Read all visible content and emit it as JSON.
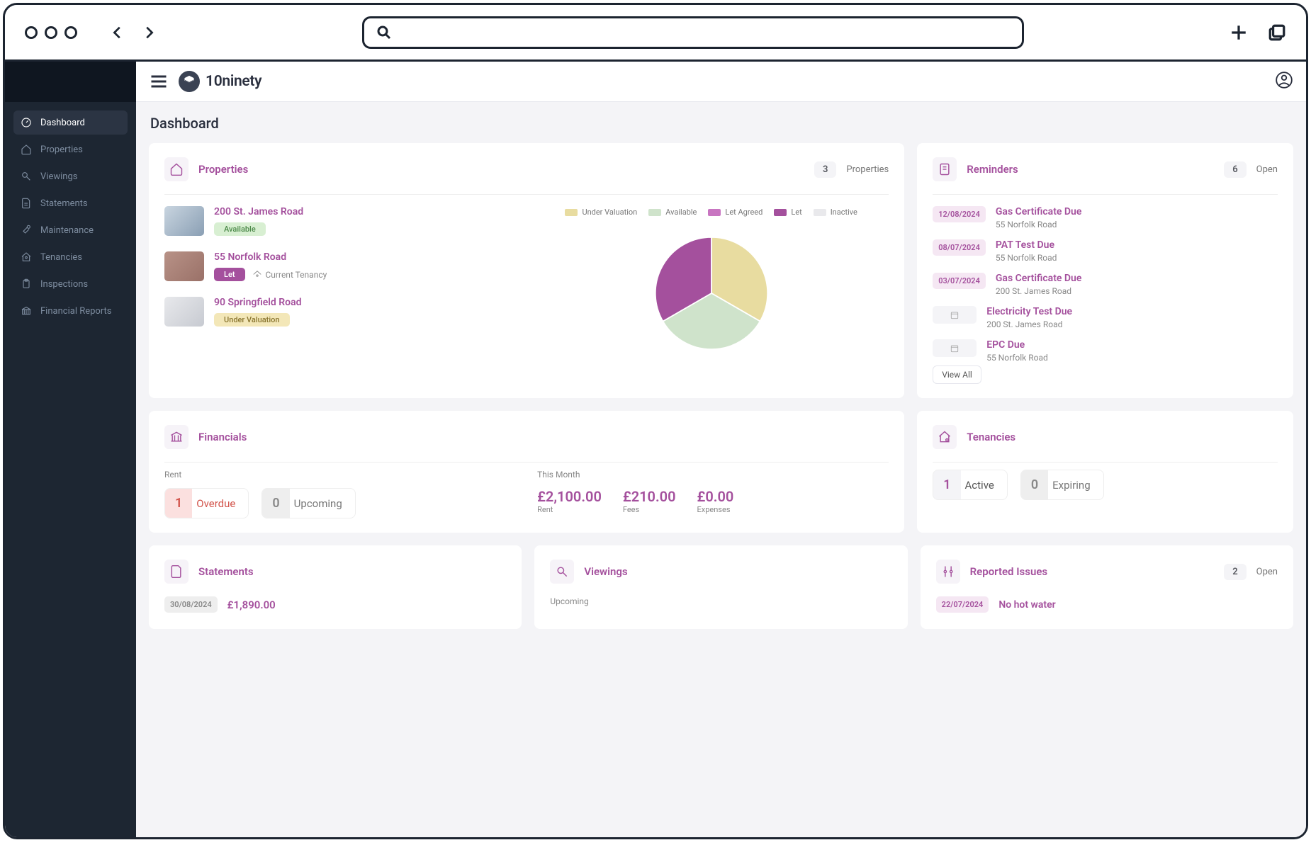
{
  "brand": {
    "name": "10ninety"
  },
  "sidebar": {
    "items": [
      {
        "label": "Dashboard",
        "active": true
      },
      {
        "label": "Properties"
      },
      {
        "label": "Viewings"
      },
      {
        "label": "Statements"
      },
      {
        "label": "Maintenance"
      },
      {
        "label": "Tenancies"
      },
      {
        "label": "Inspections"
      },
      {
        "label": "Financial Reports"
      }
    ]
  },
  "page": {
    "title": "Dashboard"
  },
  "properties_card": {
    "title": "Properties",
    "count": "3",
    "count_label": "Properties",
    "items": [
      {
        "name": "200 St. James Road",
        "badge": "Available",
        "badge_type": "avail"
      },
      {
        "name": "55 Norfolk Road",
        "badge": "Let",
        "badge_type": "let",
        "extra": "Current Tenancy"
      },
      {
        "name": "90 Springfield Road",
        "badge": "Under Valuation",
        "badge_type": "uv"
      }
    ],
    "legend": [
      {
        "label": "Under Valuation",
        "color": "#e8dca0"
      },
      {
        "label": "Available",
        "color": "#cfe3cb"
      },
      {
        "label": "Let Agreed",
        "color": "#c875c1"
      },
      {
        "label": "Let",
        "color": "#a4509d"
      },
      {
        "label": "Inactive",
        "color": "#e9e9ec"
      }
    ]
  },
  "chart_data": {
    "type": "pie",
    "title": "Properties by status",
    "series": [
      {
        "name": "Under Valuation",
        "value": 1,
        "color": "#e8dca0"
      },
      {
        "name": "Available",
        "value": 1,
        "color": "#cfe3cb"
      },
      {
        "name": "Let",
        "value": 1,
        "color": "#a4509d"
      }
    ]
  },
  "reminders_card": {
    "title": "Reminders",
    "count": "6",
    "count_label": "Open",
    "view_all": "View All",
    "items": [
      {
        "date": "12/08/2024",
        "title": "Gas Certificate Due",
        "sub": "55 Norfolk Road"
      },
      {
        "date": "08/07/2024",
        "title": "PAT Test Due",
        "sub": "55 Norfolk Road"
      },
      {
        "date": "03/07/2024",
        "title": "Gas Certificate Due",
        "sub": "200 St. James Road"
      },
      {
        "date": "",
        "title": "Electricity Test Due",
        "sub": "200 St. James Road"
      },
      {
        "date": "",
        "title": "EPC Due",
        "sub": "55 Norfolk Road"
      }
    ]
  },
  "financials_card": {
    "title": "Financials",
    "rent_label": "Rent",
    "pills": [
      {
        "num": "1",
        "lbl": "Overdue",
        "cls": "red"
      },
      {
        "num": "0",
        "lbl": "Upcoming",
        "cls": "gray"
      }
    ],
    "month_label": "This Month",
    "stats": [
      {
        "val": "£2,100.00",
        "lbl": "Rent"
      },
      {
        "val": "£210.00",
        "lbl": "Fees"
      },
      {
        "val": "£0.00",
        "lbl": "Expenses"
      }
    ]
  },
  "tenancies_card": {
    "title": "Tenancies",
    "pills": [
      {
        "num": "1",
        "lbl": "Active",
        "cls": "purple"
      },
      {
        "num": "0",
        "lbl": "Expiring",
        "cls": "gray"
      }
    ]
  },
  "statements_card": {
    "title": "Statements",
    "items": [
      {
        "date": "30/08/2024",
        "amount": "£1,890.00"
      }
    ]
  },
  "viewings_card": {
    "title": "Viewings",
    "sub": "Upcoming"
  },
  "issues_card": {
    "title": "Reported Issues",
    "count": "2",
    "count_label": "Open",
    "items": [
      {
        "date": "22/07/2024",
        "title": "No hot water"
      }
    ]
  }
}
